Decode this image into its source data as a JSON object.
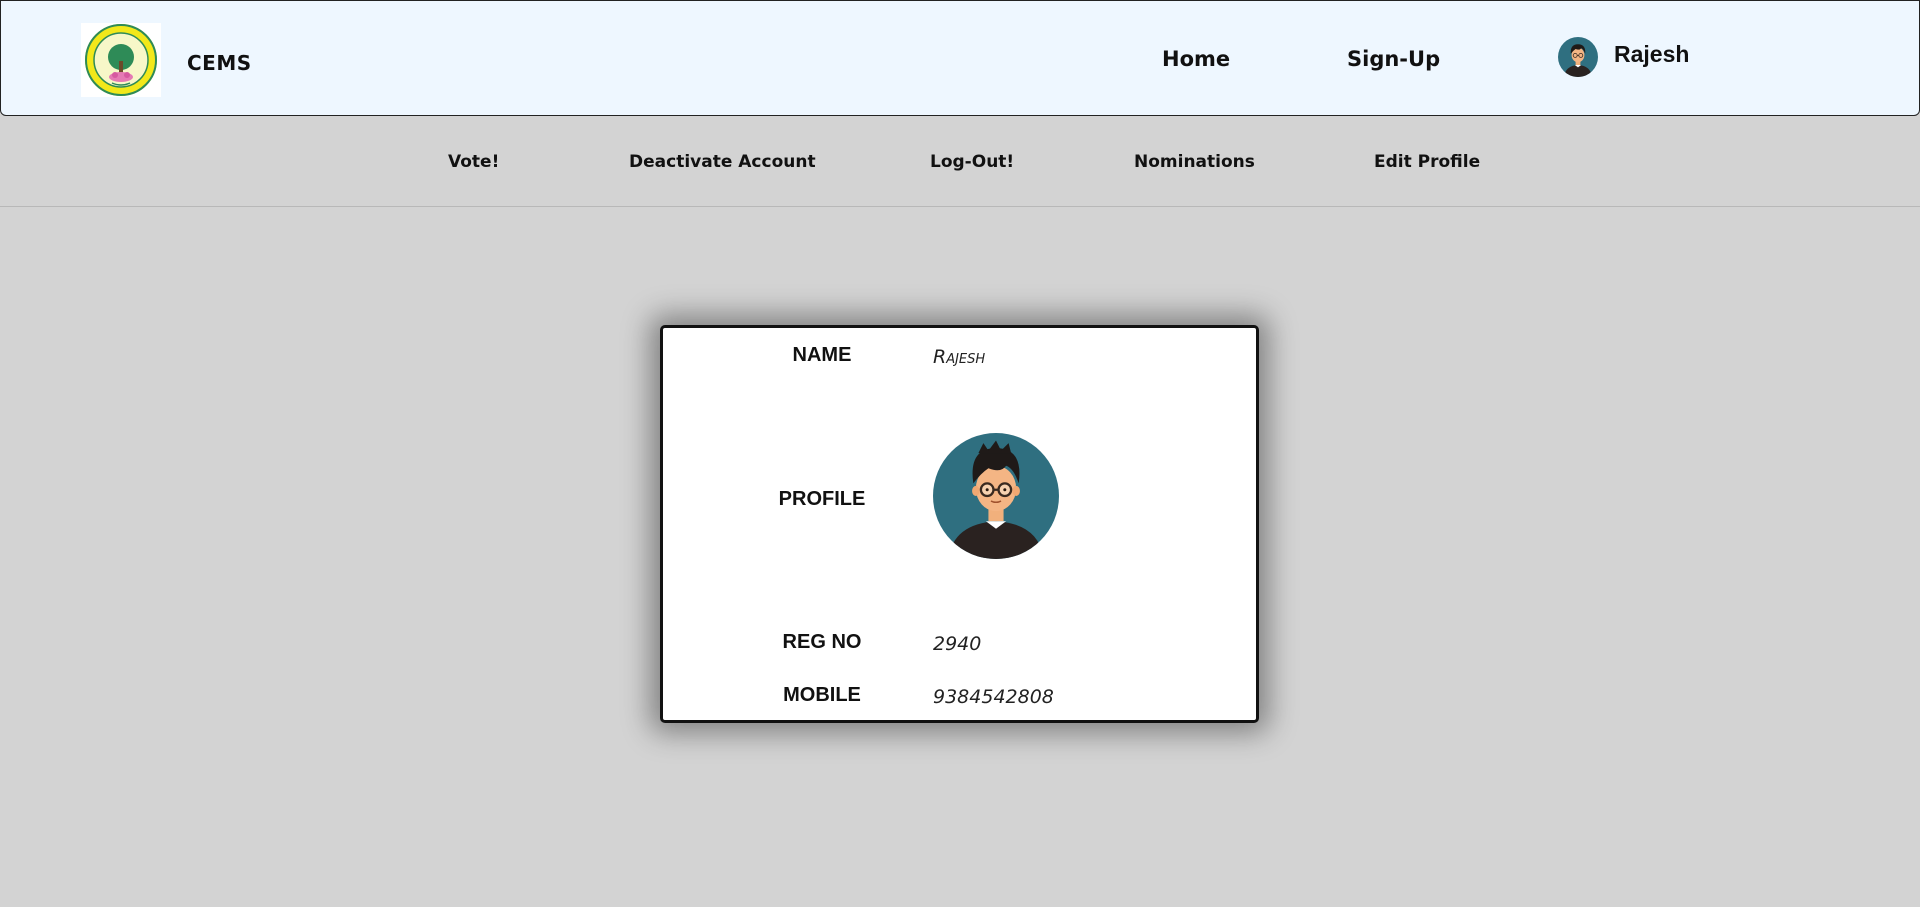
{
  "header": {
    "brand": "CEMS",
    "nav": {
      "home": "Home",
      "signup": "Sign-Up"
    },
    "user": {
      "name": "Rajesh"
    }
  },
  "subnav": {
    "vote": "Vote!",
    "deactivate": "Deactivate Account",
    "logout": "Log-Out!",
    "nominations": "Nominations",
    "edit_profile": "Edit Profile"
  },
  "profile_card": {
    "name_label": "NAME",
    "name_value": "Rajesh",
    "profile_label": "PROFILE",
    "reg_label": "REG NO",
    "reg_value": "2940",
    "mobile_label": "MOBILE",
    "mobile_value": "9384542808"
  },
  "colors": {
    "header_bg": "#eef7ff",
    "page_bg": "#d3d3d3",
    "avatar_bg": "#2f6f80"
  },
  "icons": {
    "logo": "university-seal-logo",
    "user_avatar": "user-avatar-icon"
  }
}
